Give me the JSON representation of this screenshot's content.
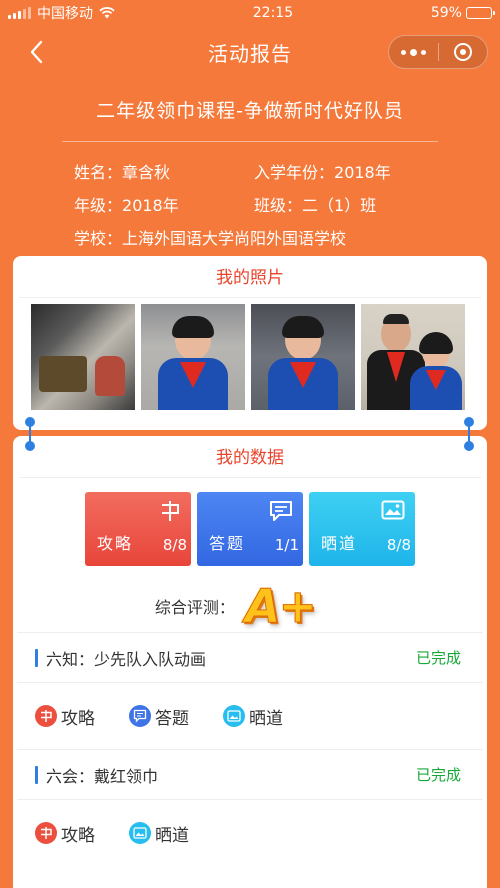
{
  "status_bar": {
    "carrier": "中国移动",
    "time": "22:15",
    "battery": "59%"
  },
  "nav": {
    "title": "活动报告"
  },
  "header": {
    "course_title": "二年级领巾课程-争做新时代好队员",
    "name_label": "姓名：",
    "name": "章含秋",
    "enroll_label": "入学年份：",
    "enroll_year": "2018年",
    "grade_label": "年级：",
    "grade": "2018年",
    "class_label": "班级：",
    "class": "二（1）班",
    "school_label": "学校：",
    "school": "上海外国语大学尚阳外国语学校"
  },
  "photos_card": {
    "title": "我的照片"
  },
  "data_card": {
    "title": "我的数据",
    "stats": [
      {
        "label": "攻略",
        "count": "8/8",
        "icon": "flag-icon",
        "color": "#e8453a"
      },
      {
        "label": "答题",
        "count": "1/1",
        "icon": "chat-bubble-icon",
        "color": "#3267e2"
      },
      {
        "label": "晒道",
        "count": "8/8",
        "icon": "image-icon",
        "color": "#1fb4ea"
      }
    ],
    "evaluation_label": "综合评测：",
    "evaluation_grade": "A+"
  },
  "tasks": [
    {
      "name": "六知：少先队入队动画",
      "status": "已完成",
      "actions": [
        "攻略",
        "答题",
        "晒道"
      ]
    },
    {
      "name": "六会：戴红领巾",
      "status": "已完成",
      "actions": [
        "攻略",
        "晒道"
      ]
    }
  ]
}
